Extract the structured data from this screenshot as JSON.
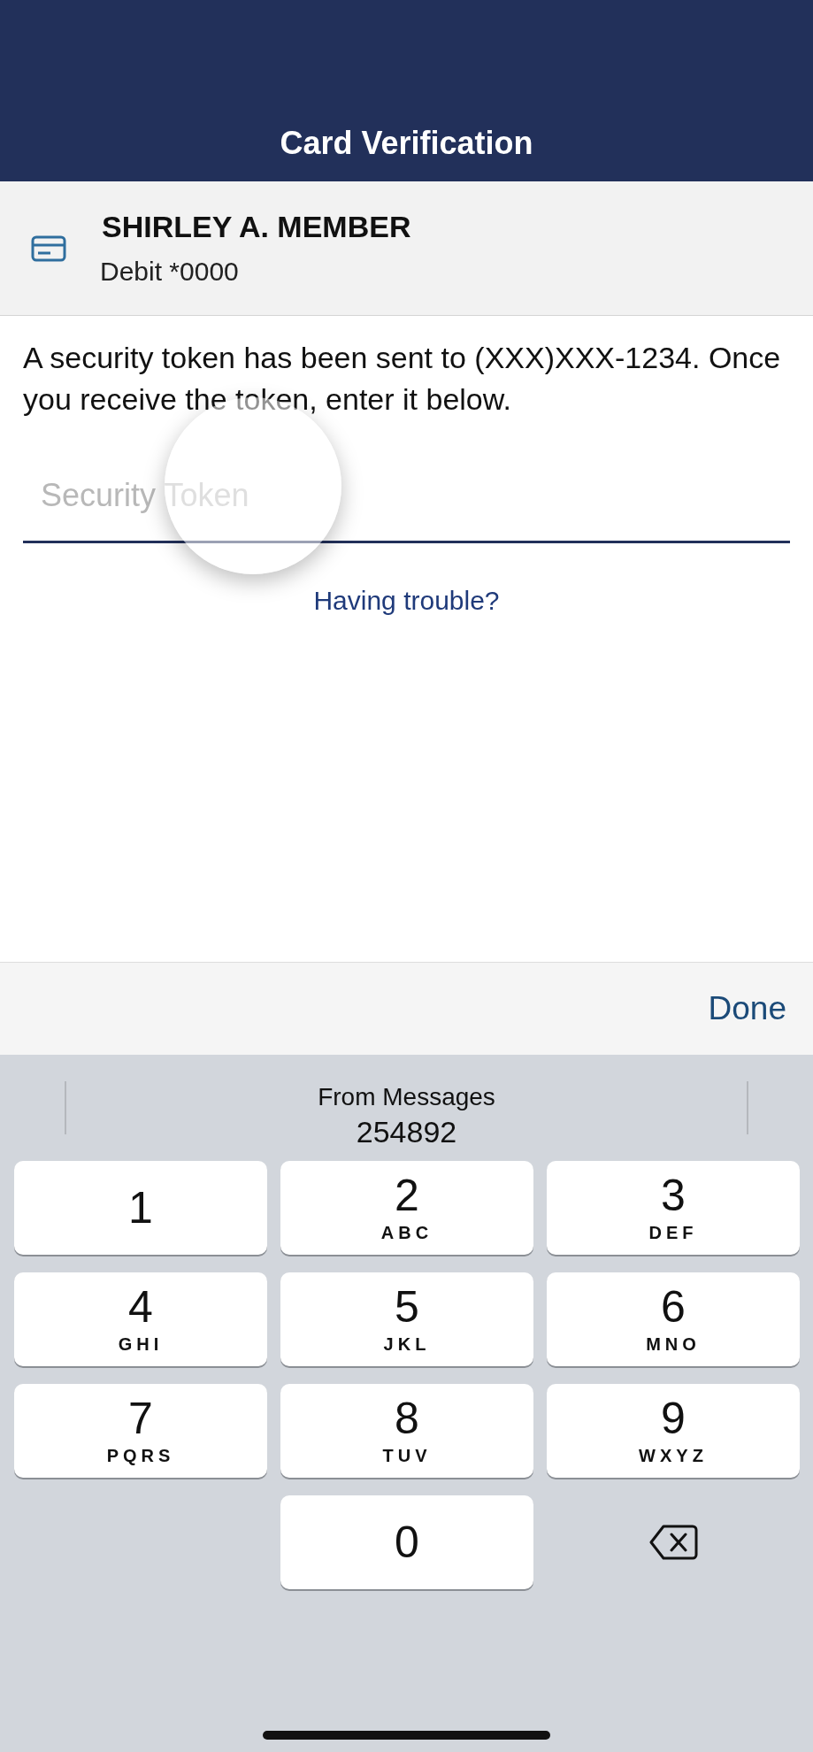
{
  "header": {
    "title": "Card Verification"
  },
  "card": {
    "name": "SHIRLEY A. MEMBER",
    "account": "Debit *0000"
  },
  "message": "A security token has been sent to (XXX)XXX-1234. Once you receive the token, enter it below.",
  "token_field": {
    "placeholder": "Security Token",
    "focused": true
  },
  "help_link": "Having trouble?",
  "toolbar": {
    "done": "Done"
  },
  "suggestion": {
    "source": "From Messages",
    "code": "254892"
  },
  "keys": [
    {
      "kind": "digit",
      "digit": "1"
    },
    {
      "kind": "digit",
      "digit": "2",
      "letters": "ABC"
    },
    {
      "kind": "digit",
      "digit": "3",
      "letters": "DEF"
    },
    {
      "kind": "digit",
      "digit": "4",
      "letters": "GHI"
    },
    {
      "kind": "digit",
      "digit": "5",
      "letters": "JKL"
    },
    {
      "kind": "digit",
      "digit": "6",
      "letters": "MNO"
    },
    {
      "kind": "digit",
      "digit": "7",
      "letters": "PQRS"
    },
    {
      "kind": "digit",
      "digit": "8",
      "letters": "TUV"
    },
    {
      "kind": "digit",
      "digit": "9",
      "letters": "WXYZ"
    },
    {
      "kind": "blank"
    },
    {
      "kind": "digit",
      "digit": "0"
    },
    {
      "kind": "delete"
    }
  ]
}
